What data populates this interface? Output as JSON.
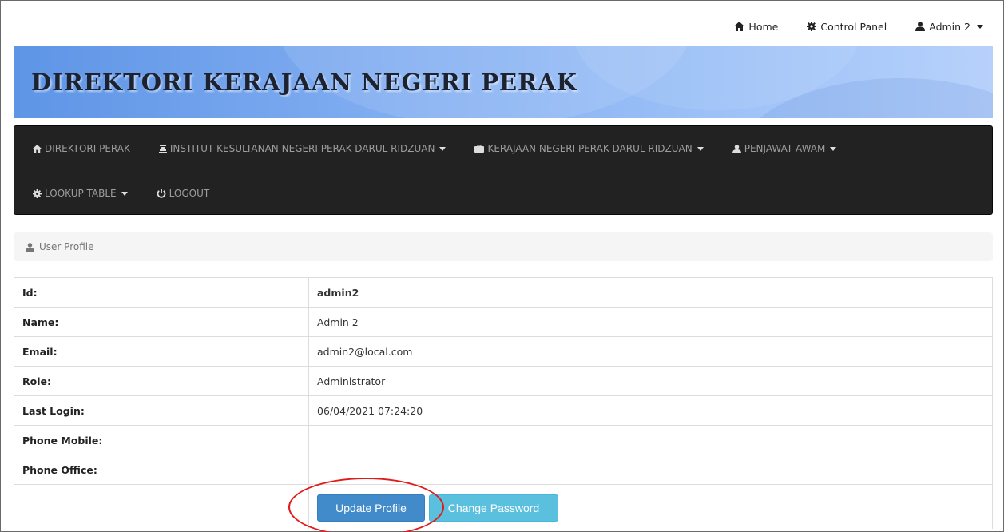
{
  "topbar": {
    "home_label": "Home",
    "control_panel_label": "Control Panel",
    "user_label": "Admin 2"
  },
  "banner": {
    "title": "DIREKTORI KERAJAAN NEGERI PERAK"
  },
  "navbar": {
    "items": [
      {
        "label": "DIREKTORI PERAK",
        "icon": "home-icon",
        "dropdown": false
      },
      {
        "label": "INSTITUT KESULTANAN NEGERI PERAK DARUL RIDZUAN",
        "icon": "throne-icon",
        "dropdown": true
      },
      {
        "label": "KERAJAAN NEGERI PERAK DARUL RIDZUAN",
        "icon": "briefcase-icon",
        "dropdown": true
      },
      {
        "label": "PENJAWAT AWAM",
        "icon": "user-icon",
        "dropdown": true
      },
      {
        "label": "LOOKUP TABLE",
        "icon": "cog-icon",
        "dropdown": true
      },
      {
        "label": "LOGOUT",
        "icon": "power-icon",
        "dropdown": false
      }
    ]
  },
  "breadcrumb": {
    "label": "User Profile"
  },
  "profile": {
    "rows": [
      {
        "label": "Id:",
        "value": "admin2"
      },
      {
        "label": "Name:",
        "value": "Admin 2"
      },
      {
        "label": "Email:",
        "value": "admin2@local.com"
      },
      {
        "label": "Role:",
        "value": "Administrator"
      },
      {
        "label": "Last Login:",
        "value": "06/04/2021 07:24:20"
      },
      {
        "label": "Phone Mobile:",
        "value": ""
      },
      {
        "label": "Phone Office:",
        "value": ""
      }
    ]
  },
  "actions": {
    "update_label": "Update Profile",
    "change_password_label": "Change Password"
  },
  "colors": {
    "primary": "#428bca",
    "info": "#5bc0de",
    "navbar": "#222222",
    "highlight": "#e01b1b"
  }
}
